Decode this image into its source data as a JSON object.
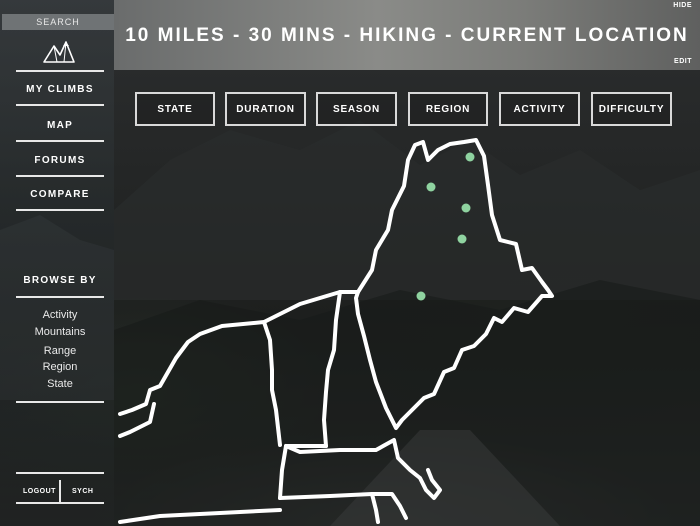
{
  "sidebar": {
    "search_label": "SEARCH",
    "nav": [
      {
        "label": "MY CLIMBS"
      },
      {
        "label": "MAP"
      },
      {
        "label": "FORUMS"
      },
      {
        "label": "COMPARE"
      }
    ],
    "browse_title": "BROWSE BY",
    "browse_items": [
      "Activity",
      "Mountains",
      "Range",
      "Region",
      "State"
    ],
    "footer": {
      "logout": "LOGOUT",
      "sync": "SYCH"
    }
  },
  "header": {
    "title": "10 MILES - 30 MINS - HIKING - CURRENT LOCATION",
    "hide": "HIDE",
    "edit": "EDIT"
  },
  "filters": [
    "STATE",
    "DURATION",
    "SEASON",
    "REGION",
    "ACTIVITY",
    "DIFFICULTY"
  ],
  "map": {
    "marker_color": "#8fd3a0",
    "outline_color": "#ffffff"
  },
  "icons": {
    "logo": "mountain-logo-icon"
  }
}
